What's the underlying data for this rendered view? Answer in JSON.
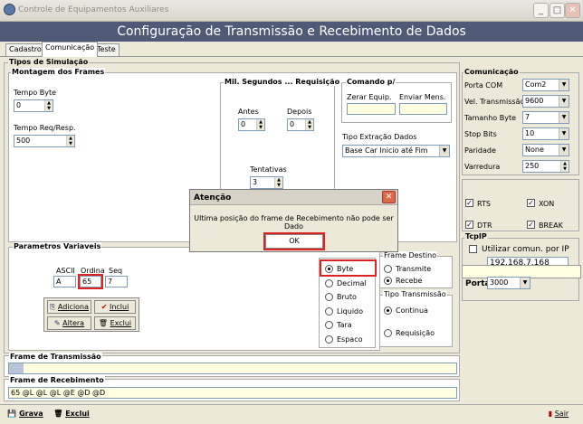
{
  "window": {
    "title": "Controle de Equipamentos Auxiliares",
    "banner": "Configuração de Transmissão e Recebimento de Dados",
    "min": "_",
    "max": "□",
    "close": "✕"
  },
  "tabs": [
    {
      "label": "Cadastro"
    },
    {
      "label": "Comunicação"
    },
    {
      "label": "Teste"
    }
  ],
  "tipos_simulacao": "Tipos de Simulação",
  "montagem": {
    "title": "Montagem dos Frames",
    "tempo_byte_label": "Tempo Byte",
    "tempo_byte_value": "0",
    "tempo_req_label": "Tempo Req/Resp.",
    "tempo_req_value": "500"
  },
  "mil": {
    "title": "Mil. Segundos ... Requisição",
    "antes_label": "Antes",
    "antes_value": "0",
    "depois_label": "Depois",
    "depois_value": "0",
    "tentativas_label": "Tentativas",
    "tentativas_value": "3"
  },
  "comando": {
    "title": "Comando p/",
    "zerar_label": "Zerar Equip.",
    "enviar_label": "Enviar Mens.",
    "tipo_extracao_label": "Tipo Extração Dados",
    "tipo_extracao_value": "Base Car Inicio até Fim"
  },
  "comunicacao": {
    "title": "Comunicação",
    "porta_label": "Porta COM",
    "porta_value": "Com2",
    "vel_label": "Vel. Transmissão",
    "vel_value": "9600",
    "tam_label": "Tamanho Byte",
    "tam_value": "7",
    "stop_label": "Stop Bits",
    "stop_value": "10",
    "paridade_label": "Paridade",
    "paridade_value": "None",
    "varredura_label": "Varredura",
    "varredura_value": "250"
  },
  "flow": {
    "rts": "RTS",
    "xon": "XON",
    "dtr": "DTR",
    "brk": "BREAK"
  },
  "tcpip": {
    "title": "TcpIP",
    "utilizar_label": "Utilizar comun. por IP",
    "ip_value": "192.168.7.168",
    "porta_label": "Porta:",
    "porta_value": "3000"
  },
  "parametros": {
    "title": "Parametros Variaveis",
    "ascii_label": "ASCII",
    "ordina_label": "Ordina",
    "seq_label": "Seq",
    "ascii_value": "A",
    "ordina_value": "65",
    "seq_value": "7",
    "adiciona": "Adiciona",
    "inclui": "Inclui",
    "altera": "Altera",
    "exclui": "Exclui"
  },
  "tipo_dado": {
    "byte": "Byte",
    "decimal": "Decimal",
    "bruto": "Bruto",
    "liquido": "Liquido",
    "tara": "Tara",
    "espaco": "Espaco"
  },
  "frame_destino": {
    "title": "Frame Destino",
    "transmite": "Transmite",
    "recebe": "Recebe"
  },
  "tipo_transmissao": {
    "title": "Tipo Transmissão",
    "continua": "Continua",
    "requisicao": "Requisição"
  },
  "frame_transmissao": {
    "title": "Frame de Transmissão",
    "value": ""
  },
  "frame_recebimento": {
    "title": "Frame de Recebimento",
    "value": "65 @L @L @L @E @D @D"
  },
  "dialog": {
    "title": "Atenção",
    "message": "Ultima posição do frame de Recebimento não pode ser Dado",
    "ok": "OK"
  },
  "statusbar": {
    "grava": "Grava",
    "exclui": "Exclui",
    "sair": "Sair"
  }
}
